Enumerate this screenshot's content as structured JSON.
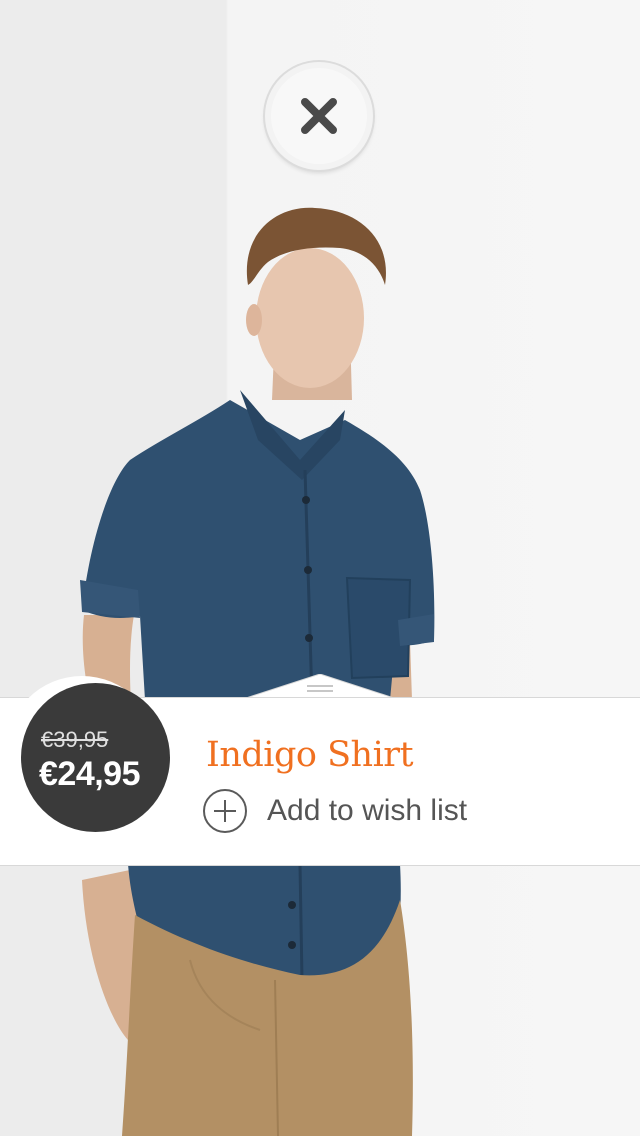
{
  "product": {
    "name": "Indigo Shirt",
    "original_price": "€39,95",
    "sale_price": "€24,95"
  },
  "actions": {
    "add_to_wishlist_label": "Add to wish list"
  },
  "icons": {
    "close": "close-icon",
    "add": "plus-icon"
  },
  "colors": {
    "accent": "#f07020",
    "badge_bg": "#3a3a3a",
    "shirt": "#2e4f70",
    "trousers": "#b39064"
  }
}
